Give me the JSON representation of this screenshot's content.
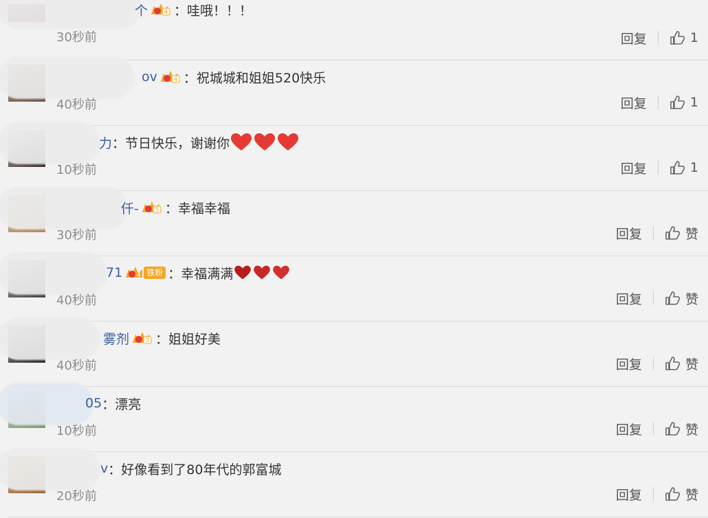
{
  "comments": [
    {
      "name": "个",
      "text": "哇哦！！！",
      "time": "30秒前",
      "reply": "回复",
      "like": "1",
      "badge": "4"
    },
    {
      "name": "ov",
      "text": "祝城城和姐姐520快乐",
      "time": "40秒前",
      "reply": "回复",
      "like": "1",
      "badge": "4"
    },
    {
      "name": "力",
      "text": "节日快乐，谢谢你",
      "time": "10秒前",
      "reply": "回复",
      "like": "1",
      "badge": ""
    },
    {
      "name": "仟-",
      "text": "幸福幸福",
      "time": "30秒前",
      "reply": "回复",
      "like": "赞",
      "badge": "5"
    },
    {
      "name": "71",
      "text": "幸福满满",
      "time": "40秒前",
      "reply": "回复",
      "like": "赞",
      "badge": "4",
      "tag": "铁粉"
    },
    {
      "name": "雾剂",
      "text": "姐姐好美",
      "time": "40秒前",
      "reply": "回复",
      "like": "赞",
      "badge": "3"
    },
    {
      "name": "05",
      "text": "漂亮",
      "time": "10秒前",
      "reply": "回复",
      "like": "赞",
      "badge": ""
    },
    {
      "name": "v",
      "text": "好像看到了80年代的郭富城",
      "time": "20秒前",
      "reply": "回复",
      "like": "赞",
      "badge": ""
    }
  ],
  "colors": {
    "name": "#3a5e9e",
    "text": "#333333",
    "meta": "#8c8c8c",
    "background": "#f2f2f2",
    "heart": "#e53935",
    "badge": "#f5a623"
  },
  "icons": {
    "like": "thumbs-up-icon",
    "badge": "crown-level-badge-icon",
    "heart": "heart-emoji-icon"
  }
}
